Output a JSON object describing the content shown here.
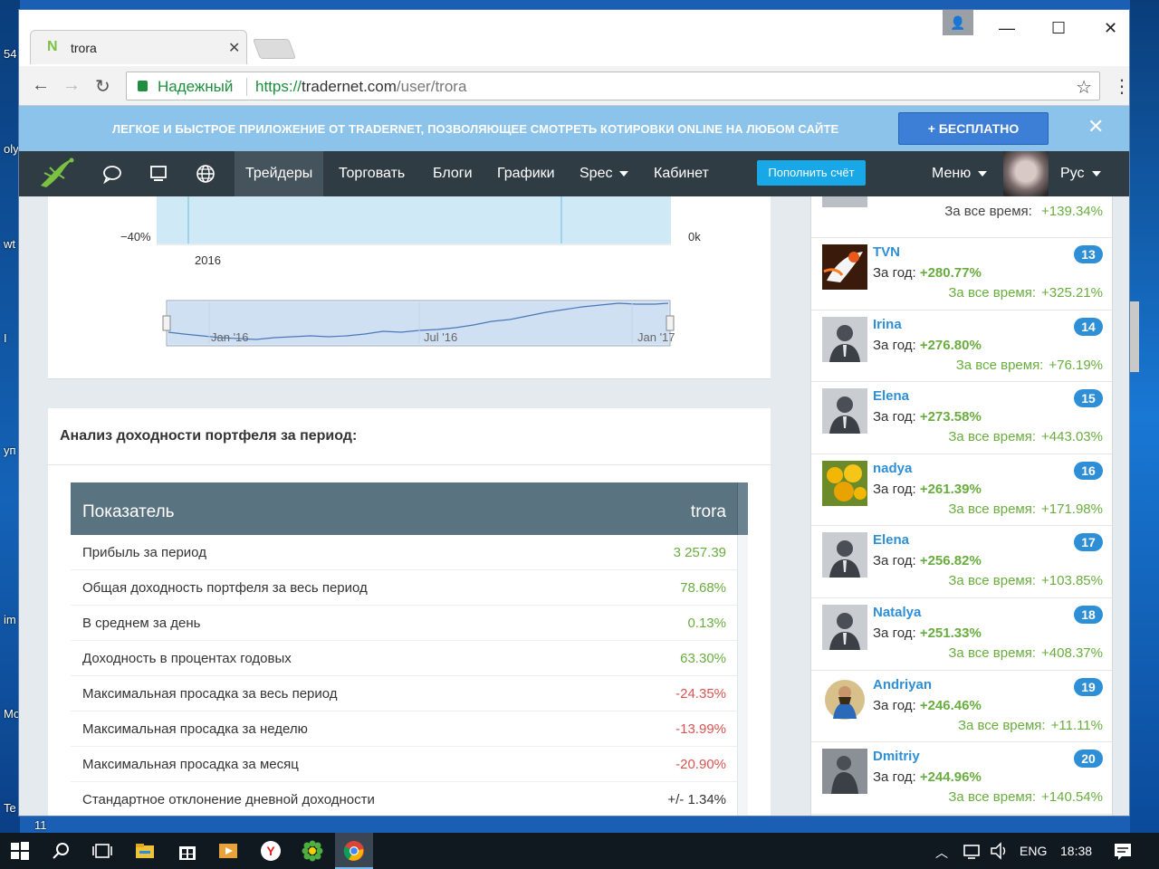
{
  "desktop": {
    "labels": [
      "54",
      "oly",
      "wt",
      "I",
      "уп",
      "im",
      "Mo",
      "Te",
      "11"
    ]
  },
  "browser": {
    "tab_title": "trora",
    "tab_favicon": "N",
    "secure_label": "Надежный",
    "url_protocol": "https://",
    "url_host": "tradernet.com",
    "url_path": "/user/trora"
  },
  "promo": {
    "text": "ЛЕГКОЕ И БЫСТРОЕ ПРИЛОЖЕНИЕ ОТ TRADERNET, ПОЗВОЛЯЮЩЕЕ СМОТРЕТЬ КОТИРОВКИ ONLINE НА ЛЮБОМ САЙТЕ",
    "button_label": "+  БЕСПЛАТНО",
    "close": "✕"
  },
  "nav": {
    "items": [
      "Трейдеры",
      "Торговать",
      "Блоги",
      "Графики",
      "Spec",
      "Кабинет"
    ],
    "topup_label": "Пополнить счёт",
    "menu_label": "Меню",
    "lang_label": "Рус"
  },
  "chart": {
    "left_tick": "−40%",
    "right_tick": "0k",
    "year_label": "2016",
    "nav_ticks": [
      "Jan '16",
      "Jul '16",
      "Jan '17"
    ]
  },
  "analysis": {
    "title": "Анализ доходности портфеля за период:",
    "col_metric": "Показатель",
    "col_user": "trora",
    "rows": [
      {
        "label": "Прибыль за период",
        "value": "3 257.39",
        "tone": "pos"
      },
      {
        "label": "Общая доходность портфеля за весь период",
        "value": "78.68%",
        "tone": "pos"
      },
      {
        "label": "В среднем за день",
        "value": "0.13%",
        "tone": "pos"
      },
      {
        "label": "Доходность в процентах годовых",
        "value": "63.30%",
        "tone": "pos"
      },
      {
        "label": "Максимальная просадка за весь период",
        "value": "-24.35%",
        "tone": "neg"
      },
      {
        "label": "Максимальная просадка за неделю",
        "value": "-13.99%",
        "tone": "neg"
      },
      {
        "label": "Максимальная просадка за месяц",
        "value": "-20.90%",
        "tone": "neg"
      },
      {
        "label": "Стандартное отклонение дневной доходности",
        "value": "+/- 1.34%",
        "tone": "neu"
      }
    ]
  },
  "sidebar": {
    "top_alltime_label": "За все время:",
    "top_alltime_value": "+139.34%",
    "year_label": "За год:",
    "alltime_label": "За все время:",
    "traders": [
      {
        "name": "TVN",
        "year": "+280.77%",
        "all": "+325.21%",
        "rank": "13",
        "avatar": "wolf"
      },
      {
        "name": "Irina",
        "year": "+276.80%",
        "all": "+76.19%",
        "rank": "14",
        "avatar": "silhouette"
      },
      {
        "name": "Elena",
        "year": "+273.58%",
        "all": "+443.03%",
        "rank": "15",
        "avatar": "silhouette"
      },
      {
        "name": "nadya",
        "year": "+261.39%",
        "all": "+171.98%",
        "rank": "16",
        "avatar": "flowers"
      },
      {
        "name": "Elena",
        "year": "+256.82%",
        "all": "+103.85%",
        "rank": "17",
        "avatar": "silhouette"
      },
      {
        "name": "Natalya",
        "year": "+251.33%",
        "all": "+408.37%",
        "rank": "18",
        "avatar": "silhouette"
      },
      {
        "name": "Andriyan",
        "year": "+246.46%",
        "all": "+11.11%",
        "rank": "19",
        "avatar": "portrait"
      },
      {
        "name": "Dmitriy",
        "year": "+244.96%",
        "all": "+140.54%",
        "rank": "20",
        "avatar": "statue"
      }
    ]
  },
  "taskbar": {
    "lang": "ENG",
    "time": "18:38"
  },
  "colors": {
    "positive": "#69ad3f",
    "negative": "#d9534f",
    "link": "#2e8fd6",
    "nav_bg": "#2f3c44",
    "header_bg": "#5a7380"
  }
}
